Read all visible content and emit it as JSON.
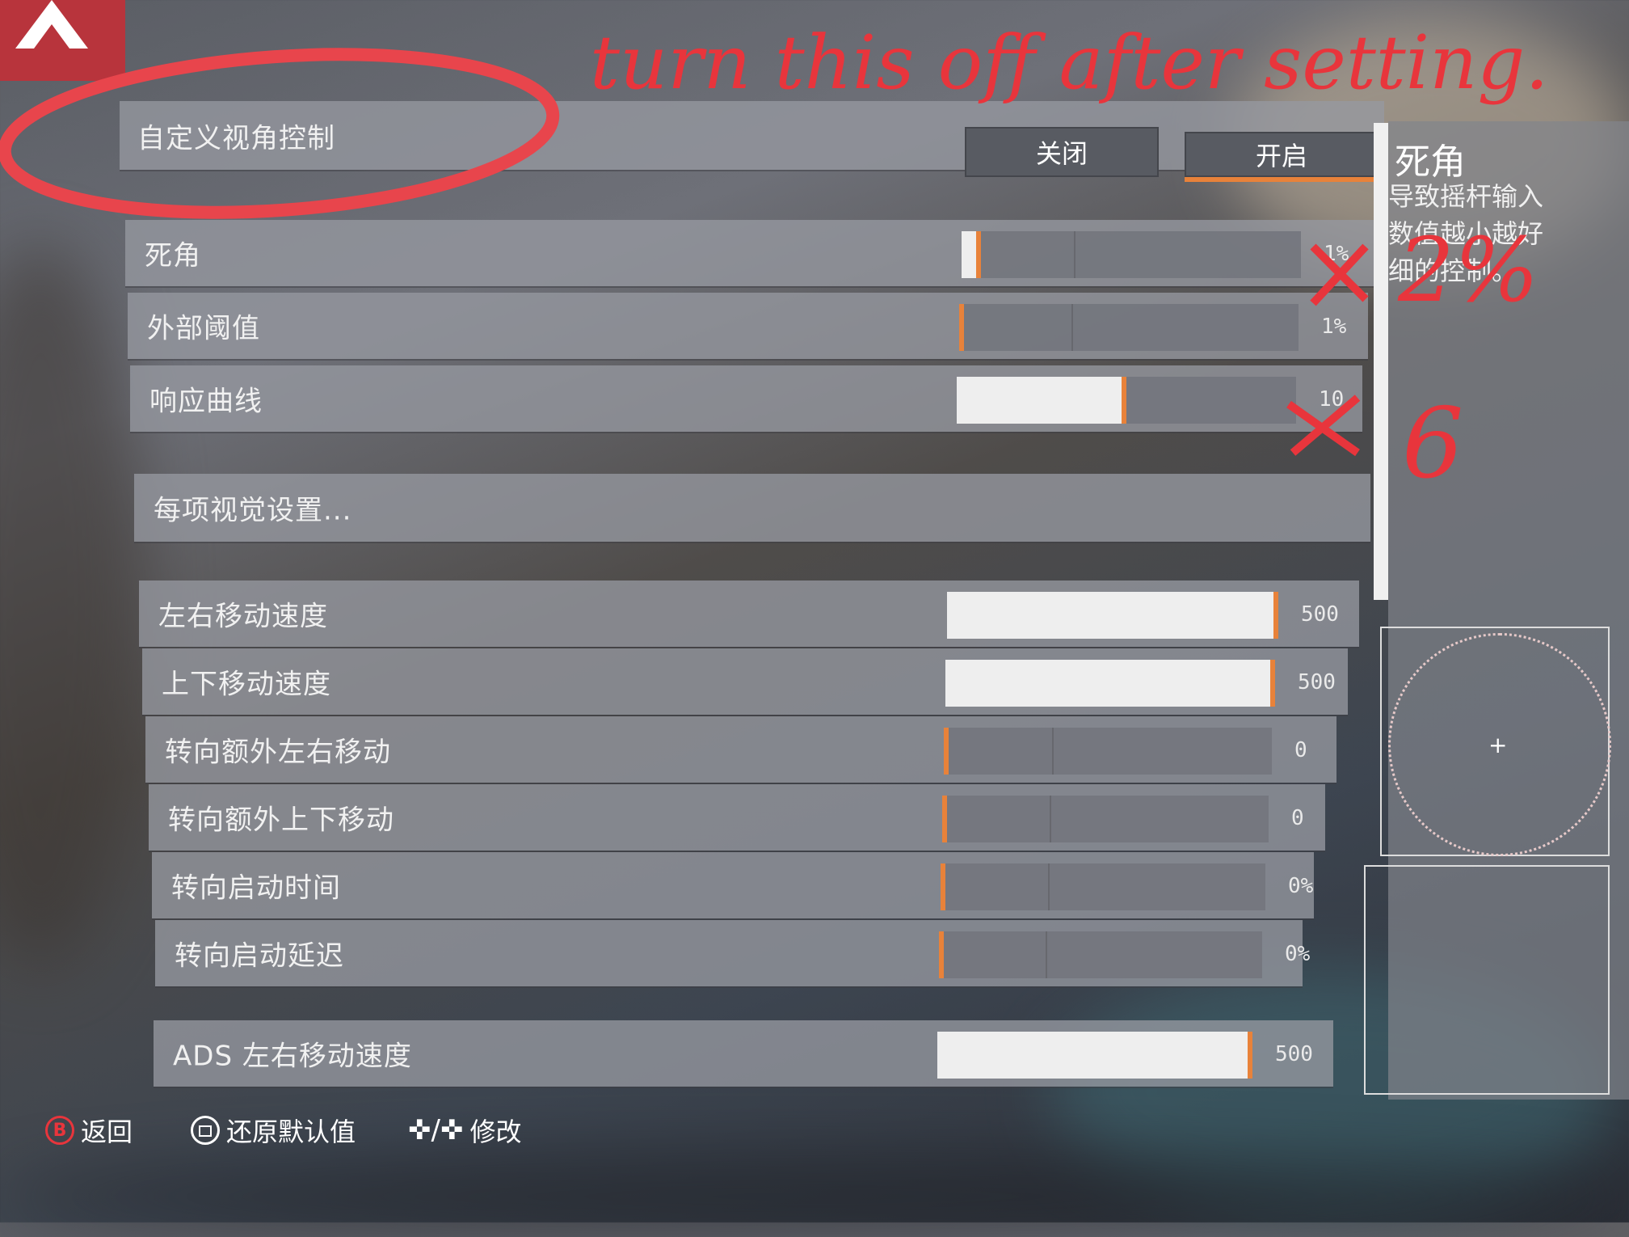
{
  "annotations": {
    "note": "turn this off after setting.",
    "mark_deadzone": "2%",
    "mark_curve": "6"
  },
  "toggle_row": {
    "label": "自定义视角控制",
    "off": "关闭",
    "on": "开启",
    "selected": "开启"
  },
  "sliders_a": [
    {
      "label": "死角",
      "value_text": "1%",
      "level": 0.02
    },
    {
      "label": "外部阈值",
      "value_text": "1%",
      "level": 0.0
    },
    {
      "label": "响应曲线",
      "value_text": "10",
      "level": 0.5
    }
  ],
  "per_setting_link": "每项视觉设置...",
  "sliders_b": [
    {
      "label": "左右移动速度",
      "value_text": "500",
      "level": 1.0
    },
    {
      "label": "上下移动速度",
      "value_text": "500",
      "level": 1.0
    },
    {
      "label": "转向额外左右移动",
      "value_text": "0",
      "level": 0.0
    },
    {
      "label": "转向额外上下移动",
      "value_text": "0",
      "level": 0.0
    },
    {
      "label": "转向启动时间",
      "value_text": "0%",
      "level": 0.0
    },
    {
      "label": "转向启动延迟",
      "value_text": "0%",
      "level": 0.0
    }
  ],
  "slider_ads": {
    "label": "ADS 左右移动速度",
    "value_text": "500",
    "level": 1.0
  },
  "side_panel": {
    "title": "死角",
    "desc1": "导致摇杆输入",
    "desc2": "数值越小越好",
    "desc3": "细的控制。"
  },
  "footer": {
    "back": "返回",
    "reset": "还原默认值",
    "modify": "修改",
    "b_glyph": "B"
  },
  "colors": {
    "accent": "#e8823a",
    "annotation": "#e8353c"
  }
}
